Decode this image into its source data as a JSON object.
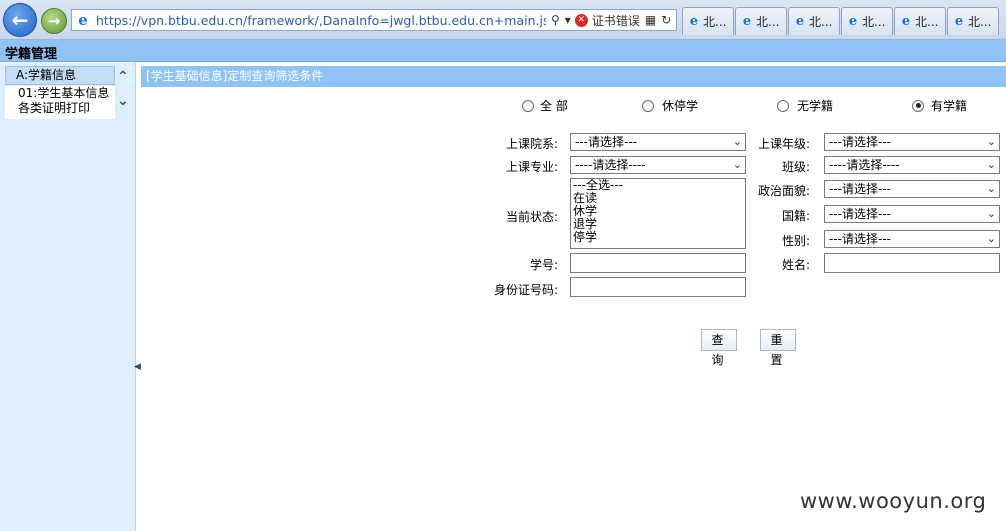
{
  "browser": {
    "url": "https://vpn.btbu.edu.cn/framework/,DanaInfo=jwgl.btbu.edu.cn+main.jsp",
    "cert_error": "证书错误",
    "tabs": [
      "北...",
      "北...",
      "北...",
      "北...",
      "北...",
      "北..."
    ]
  },
  "app": {
    "title": "学籍管理"
  },
  "sidebar": {
    "header": "A:学籍信息",
    "items": [
      {
        "label_line1": "01:学生基本信息",
        "label_line2": "各类证明打印"
      }
    ]
  },
  "main": {
    "title": "[学生基础信息]定制查询筛选条件",
    "radios": [
      {
        "label": "全 部",
        "checked": false
      },
      {
        "label": "休停学",
        "checked": false
      },
      {
        "label": "无学籍",
        "checked": false
      },
      {
        "label": "有学籍",
        "checked": true
      }
    ],
    "form": {
      "college": {
        "label": "上课院系:",
        "value": "---请选择---"
      },
      "grade": {
        "label": "上课年级:",
        "value": "---请选择---"
      },
      "major": {
        "label": "上课专业:",
        "value": "----请选择----"
      },
      "class": {
        "label": "班级:",
        "value": "----请选择----"
      },
      "status": {
        "label": "当前状态:",
        "options": [
          "---全选---",
          "在读",
          "休学",
          "退学",
          "停学"
        ]
      },
      "politics": {
        "label": "政治面貌:",
        "value": "---请选择---"
      },
      "nationality": {
        "label": "国籍:",
        "value": "---请选择---"
      },
      "gender": {
        "label": "性别:",
        "value": "---请选择---"
      },
      "student_id": {
        "label": "学号:",
        "value": ""
      },
      "name": {
        "label": "姓名:",
        "value": ""
      },
      "id_card": {
        "label": "身份证号码:",
        "value": ""
      }
    },
    "buttons": {
      "query": "查 询",
      "reset": "重 置"
    }
  },
  "watermark": "www.wooyun.org"
}
